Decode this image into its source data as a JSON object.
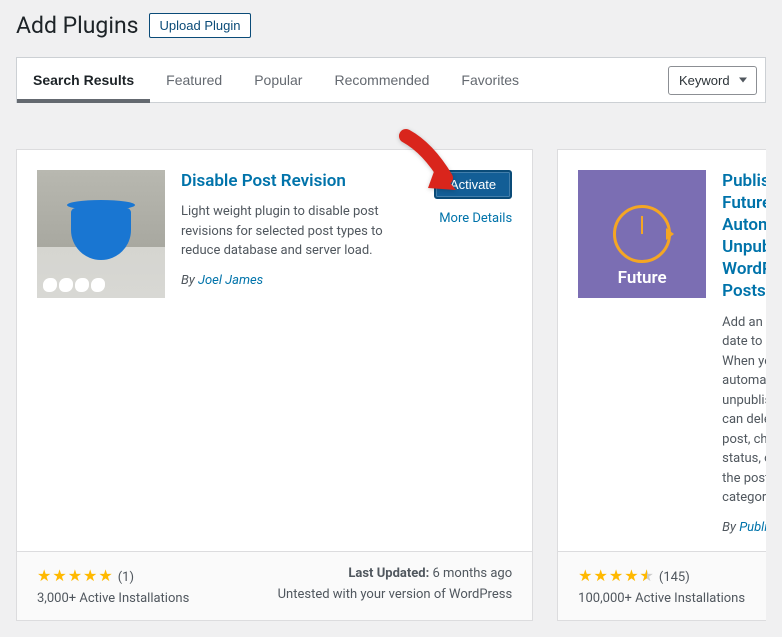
{
  "header": {
    "title": "Add Plugins",
    "upload_label": "Upload Plugin"
  },
  "tabs": {
    "items": [
      "Search Results",
      "Featured",
      "Popular",
      "Recommended",
      "Favorites"
    ],
    "active_index": 0
  },
  "filter": {
    "selected": "Keyword"
  },
  "plugins": [
    {
      "title": "Disable Post Revision",
      "description": "Light weight plugin to disable post revisions for selected post types to reduce database and server load.",
      "author_prefix": "By ",
      "author": "Joel James",
      "action_label": "Activate",
      "more_label": "More Details",
      "rating_stars": 5,
      "rating_count": "(1)",
      "installs": "3,000+ Active Installations",
      "last_updated_label": "Last Updated:",
      "last_updated": "6 months ago",
      "compat": "Untested with your version of WordPress",
      "thumb_label": ""
    },
    {
      "title": "PublishPress Future: Automatically Unpublish WordPress Posts",
      "description": "Add an expiration date to posts. When your post is automatically unpublished, you can delete the post, change the status, or update the post categories.",
      "author_prefix": "By ",
      "author": "PublishPress",
      "rating_stars": 4.5,
      "rating_count": "(145)",
      "installs": "100,000+ Active Installations",
      "thumb_label": "Future"
    }
  ]
}
